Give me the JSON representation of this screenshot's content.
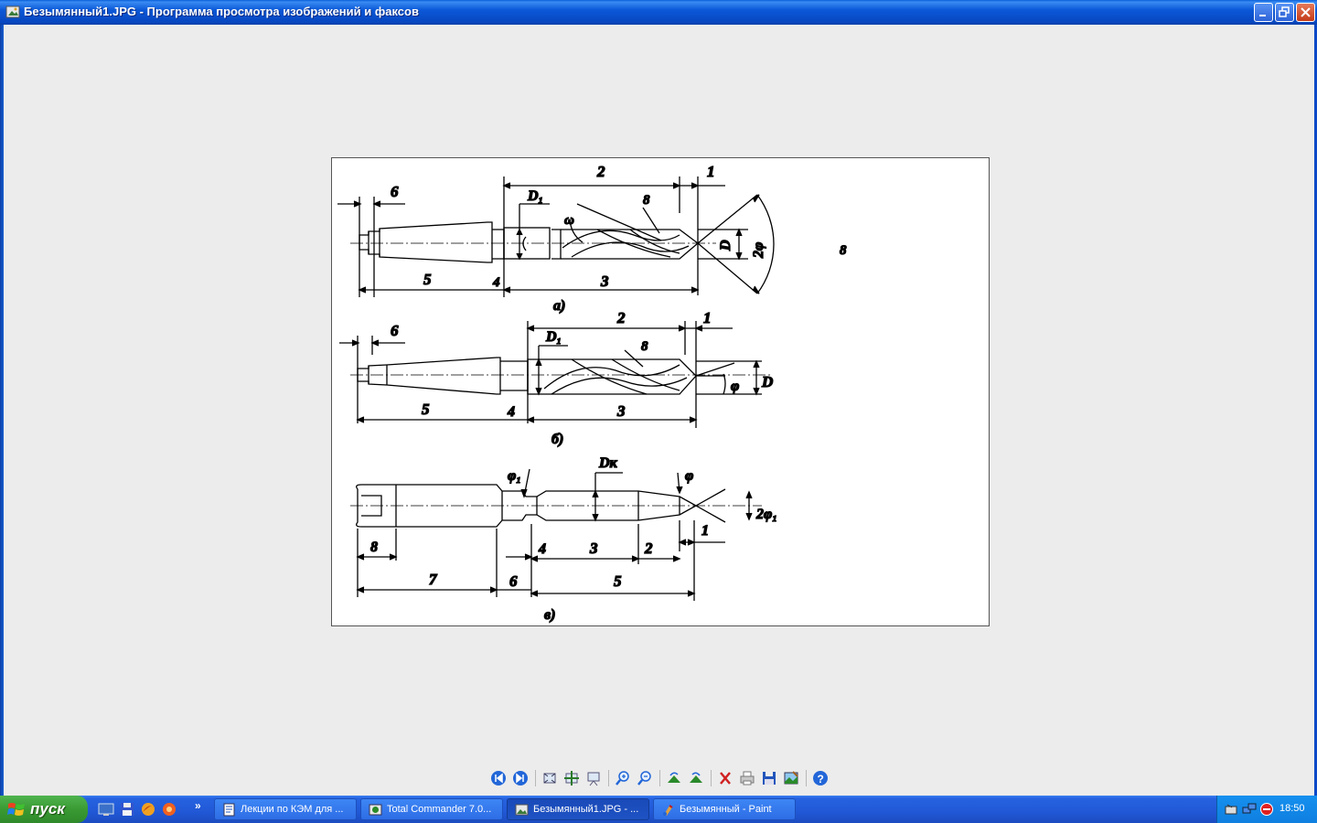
{
  "window": {
    "title": "Безымянный1.JPG - Программа просмотра изображений и факсов"
  },
  "image": {
    "fig_a": {
      "label_6": "6",
      "label_D1": "D₁",
      "label_2": "2",
      "label_1": "1",
      "label_8": "8",
      "label_omega": "ω",
      "label_D": "D",
      "label_2phi": "2φ",
      "label_5": "5",
      "label_4": "4",
      "label_3": "3",
      "caption": "а)"
    },
    "fig_b": {
      "label_6": "6",
      "label_D1": "D₁",
      "label_2": "2",
      "label_1": "1",
      "label_8": "8",
      "label_phi": "φ",
      "label_D": "D",
      "label_5": "5",
      "label_4": "4",
      "label_3": "3",
      "caption": "б)"
    },
    "fig_c": {
      "label_phi1": "φ₁",
      "label_Dk": "Dк",
      "label_phi": "φ",
      "label_2phi": "2φ₁",
      "label_1": "1",
      "label_8": "8",
      "label_4": "4",
      "label_3": "3",
      "label_2": "2",
      "label_7": "7",
      "label_6": "6",
      "label_5": "5",
      "caption": "в)"
    },
    "stray_label": "8"
  },
  "toolbar": {
    "buttons": [
      {
        "icon": "previous-image-icon"
      },
      {
        "icon": "next-image-icon"
      },
      {
        "icon": "best-fit-icon"
      },
      {
        "icon": "actual-size-icon"
      },
      {
        "icon": "slideshow-icon"
      },
      {
        "icon": "zoom-in-icon"
      },
      {
        "icon": "zoom-out-icon"
      },
      {
        "icon": "rotate-clockwise-icon"
      },
      {
        "icon": "rotate-counterclockwise-icon"
      },
      {
        "icon": "delete-icon"
      },
      {
        "icon": "print-icon"
      },
      {
        "icon": "save-icon"
      },
      {
        "icon": "open-in-editor-icon"
      },
      {
        "icon": "help-icon"
      }
    ]
  },
  "taskbar": {
    "start_label": "пуск",
    "overflow": "»",
    "items": [
      {
        "label": "Лекции по КЭМ для ...",
        "icon": "word-document-icon"
      },
      {
        "label": "Total Commander 7.0...",
        "icon": "total-commander-icon"
      },
      {
        "label": "Безымянный1.JPG - ...",
        "icon": "image-viewer-icon",
        "active": true
      },
      {
        "label": "Безымянный - Paint",
        "icon": "paint-icon"
      }
    ],
    "clock": "18:50"
  },
  "colors": {
    "titlebar": "#0b58d8",
    "taskbar": "#2158d6",
    "start": "#3a9a33",
    "tray": "#0f7fe0",
    "background": "#ececec"
  }
}
